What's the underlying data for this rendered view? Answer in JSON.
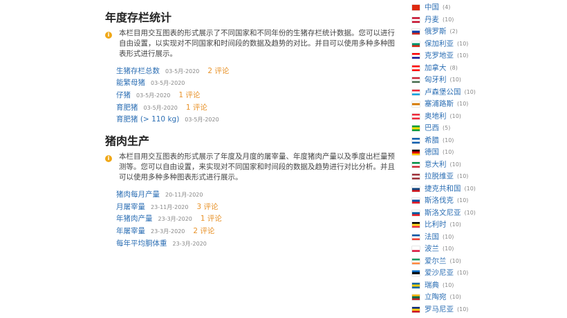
{
  "sections": [
    {
      "title": "年度存栏统计",
      "description": "本栏目用交互图表的形式展示了不同国家和不同年份的生猪存栏统计数据。您可以进行自由设置，以实现对不同国家和时间段的数据及趋势的对比。并目可以使用多种多种图表形式进行展示。",
      "items": [
        {
          "label": "生猪存栏总数",
          "date": "03-5月-2020",
          "comments": "2 评论"
        },
        {
          "label": "能繁母猪",
          "date": "03-5月-2020",
          "comments": ""
        },
        {
          "label": "仔猪",
          "date": "03-5月-2020",
          "comments": "1 评论"
        },
        {
          "label": "育肥猪",
          "date": "03-5月-2020",
          "comments": "1 评论"
        },
        {
          "label": "育肥猪 (> 110 kg)",
          "date": "03-5月-2020",
          "comments": ""
        }
      ]
    },
    {
      "title": "猪肉生产",
      "description": "本栏目用交互图表的形式展示了年度及月度的屠宰量、年度猪肉产量以及季度出栏量预测等。您可以自由设置，来实现对不同国家和时间段的数据及趋势进行对比分析。并且可以使用多种多种图表形式进行展示。",
      "items": [
        {
          "label": "猪肉每月产量",
          "date": "20-11月-2020",
          "comments": ""
        },
        {
          "label": "月屠宰量",
          "date": "23-11月-2020",
          "comments": "3 评论"
        },
        {
          "label": "年猪肉产量",
          "date": "23-3月-2020",
          "comments": "1 评论"
        },
        {
          "label": "年屠宰量",
          "date": "23-3月-2020",
          "comments": "2 评论"
        },
        {
          "label": "每年平均胴体重",
          "date": "23-3月-2020",
          "comments": ""
        }
      ]
    }
  ],
  "countries": [
    {
      "name": "中国",
      "count": "(4)",
      "flag": [
        "#de2910",
        "#de2910",
        "#de2910"
      ]
    },
    {
      "name": "丹麦",
      "count": "(10)",
      "flag": [
        "#c8102e",
        "#ffffff",
        "#c8102e"
      ]
    },
    {
      "name": "俄罗斯",
      "count": "(2)",
      "flag": [
        "#ffffff",
        "#0039a6",
        "#d52b1e"
      ]
    },
    {
      "name": "保加利亚",
      "count": "(10)",
      "flag": [
        "#ffffff",
        "#00966e",
        "#d62612"
      ]
    },
    {
      "name": "克罗地亚",
      "count": "(10)",
      "flag": [
        "#ff0000",
        "#ffffff",
        "#171796"
      ]
    },
    {
      "name": "加拿大",
      "count": "(8)",
      "flag": [
        "#ff0000",
        "#ffffff",
        "#ff0000"
      ]
    },
    {
      "name": "匈牙利",
      "count": "(10)",
      "flag": [
        "#ce2939",
        "#ffffff",
        "#477050"
      ]
    },
    {
      "name": "卢森堡公国",
      "count": "(10)",
      "flag": [
        "#ed2939",
        "#ffffff",
        "#00a1de"
      ]
    },
    {
      "name": "塞浦路斯",
      "count": "(10)",
      "flag": [
        "#ffffff",
        "#d57800",
        "#ffffff"
      ]
    },
    {
      "name": "奥地利",
      "count": "(10)",
      "flag": [
        "#ed2939",
        "#ffffff",
        "#ed2939"
      ]
    },
    {
      "name": "巴西",
      "count": "(5)",
      "flag": [
        "#009c3b",
        "#ffdf00",
        "#009c3b"
      ]
    },
    {
      "name": "希腊",
      "count": "(10)",
      "flag": [
        "#0d5eaf",
        "#ffffff",
        "#0d5eaf"
      ]
    },
    {
      "name": "德国",
      "count": "(10)",
      "flag": [
        "#000000",
        "#dd0000",
        "#ffce00"
      ]
    },
    {
      "name": "意大利",
      "count": "(10)",
      "flag": [
        "#009246",
        "#ffffff",
        "#ce2b37"
      ]
    },
    {
      "name": "拉脱维亚",
      "count": "(10)",
      "flag": [
        "#9e3039",
        "#ffffff",
        "#9e3039"
      ]
    },
    {
      "name": "捷克共和国",
      "count": "(10)",
      "flag": [
        "#ffffff",
        "#11457e",
        "#d7141a"
      ]
    },
    {
      "name": "斯洛伐克",
      "count": "(10)",
      "flag": [
        "#ffffff",
        "#0b4ea2",
        "#ee1c25"
      ]
    },
    {
      "name": "斯洛文尼亚",
      "count": "(10)",
      "flag": [
        "#ffffff",
        "#005da4",
        "#ed1c24"
      ]
    },
    {
      "name": "比利时",
      "count": "(10)",
      "flag": [
        "#000000",
        "#fdda24",
        "#ef3340"
      ]
    },
    {
      "name": "法国",
      "count": "(10)",
      "flag": [
        "#0055a4",
        "#ffffff",
        "#ef4135"
      ]
    },
    {
      "name": "波兰",
      "count": "(10)",
      "flag": [
        "#ffffff",
        "#ffffff",
        "#dc143c"
      ]
    },
    {
      "name": "爱尔兰",
      "count": "(10)",
      "flag": [
        "#169b62",
        "#ffffff",
        "#ff883e"
      ]
    },
    {
      "name": "爱沙尼亚",
      "count": "(10)",
      "flag": [
        "#0072ce",
        "#000000",
        "#ffffff"
      ]
    },
    {
      "name": "瑞典",
      "count": "(10)",
      "flag": [
        "#006aa7",
        "#fecc00",
        "#006aa7"
      ]
    },
    {
      "name": "立陶宛",
      "count": "(10)",
      "flag": [
        "#fdb913",
        "#006a44",
        "#c1272d"
      ]
    },
    {
      "name": "罗马尼亚",
      "count": "(10)",
      "flag": [
        "#002b7f",
        "#fcd116",
        "#ce1126"
      ]
    }
  ]
}
